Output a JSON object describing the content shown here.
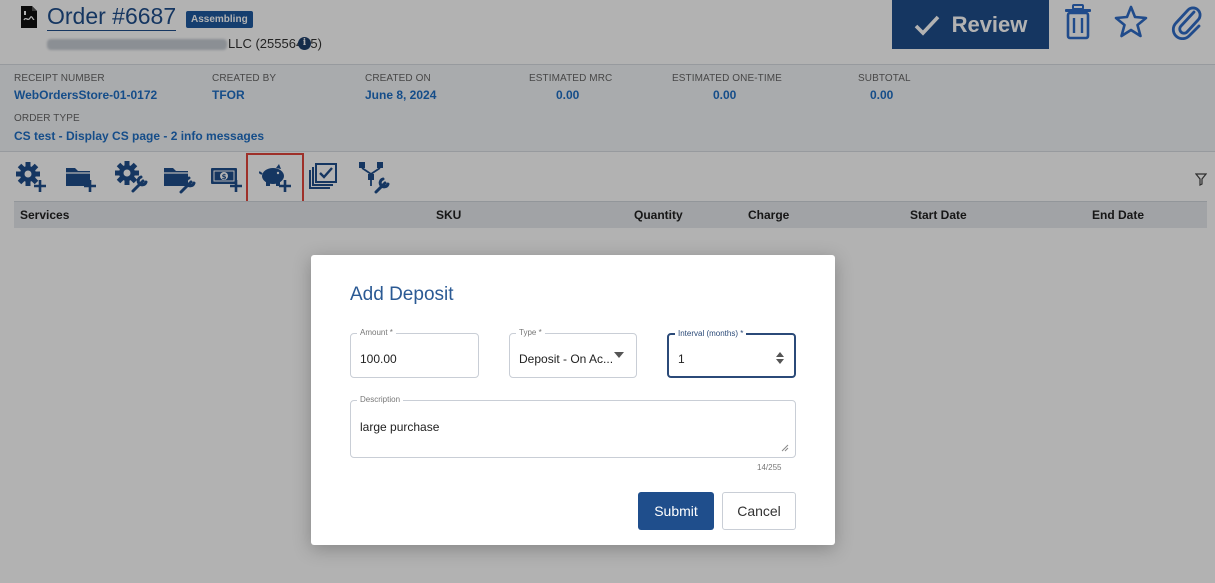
{
  "header": {
    "order_title": "Order #6687",
    "status_badge": "Assembling",
    "customer_suffix": "LLC (25556485)",
    "review_label": "Review",
    "icons": [
      "document-icon",
      "info-icon",
      "check-icon",
      "trash-icon",
      "star-icon",
      "paperclip-icon"
    ]
  },
  "summary": {
    "receipt_number": {
      "label": "RECEIPT NUMBER",
      "value": "WebOrdersStore-01-0172"
    },
    "created_by": {
      "label": "CREATED BY",
      "value": "TFOR"
    },
    "created_on": {
      "label": "CREATED ON",
      "value": "June 8, 2024"
    },
    "estimated_mrc": {
      "label": "ESTIMATED MRC",
      "value": "0.00"
    },
    "estimated_one_time": {
      "label": "ESTIMATED ONE-TIME",
      "value": "0.00"
    },
    "subtotal": {
      "label": "SUBTOTAL",
      "value": "0.00"
    },
    "order_type": {
      "label": "ORDER TYPE",
      "value": "CS test - Display CS page - 2 info messages"
    }
  },
  "toolbar": {
    "items": [
      "add-service-icon",
      "add-folder-icon",
      "configure-service-icon",
      "configure-folder-icon",
      "add-charge-icon",
      "add-deposit-icon",
      "checklist-icon",
      "hierarchy-config-icon"
    ],
    "highlighted": "add-deposit-icon",
    "accent_color": "#1f4e8c",
    "highlight_color": "#e2453c"
  },
  "table": {
    "columns": [
      "Services",
      "SKU",
      "Quantity",
      "Charge",
      "Start Date",
      "End Date"
    ]
  },
  "modal": {
    "title": "Add Deposit",
    "amount": {
      "label": "Amount *",
      "value": "100.00"
    },
    "type": {
      "label": "Type *",
      "value": "Deposit - On Ac..."
    },
    "interval": {
      "label": "Interval (months) *",
      "value": "1"
    },
    "description": {
      "label": "Description",
      "value": "large purchase"
    },
    "char_count": "14/255",
    "submit_label": "Submit",
    "cancel_label": "Cancel"
  }
}
